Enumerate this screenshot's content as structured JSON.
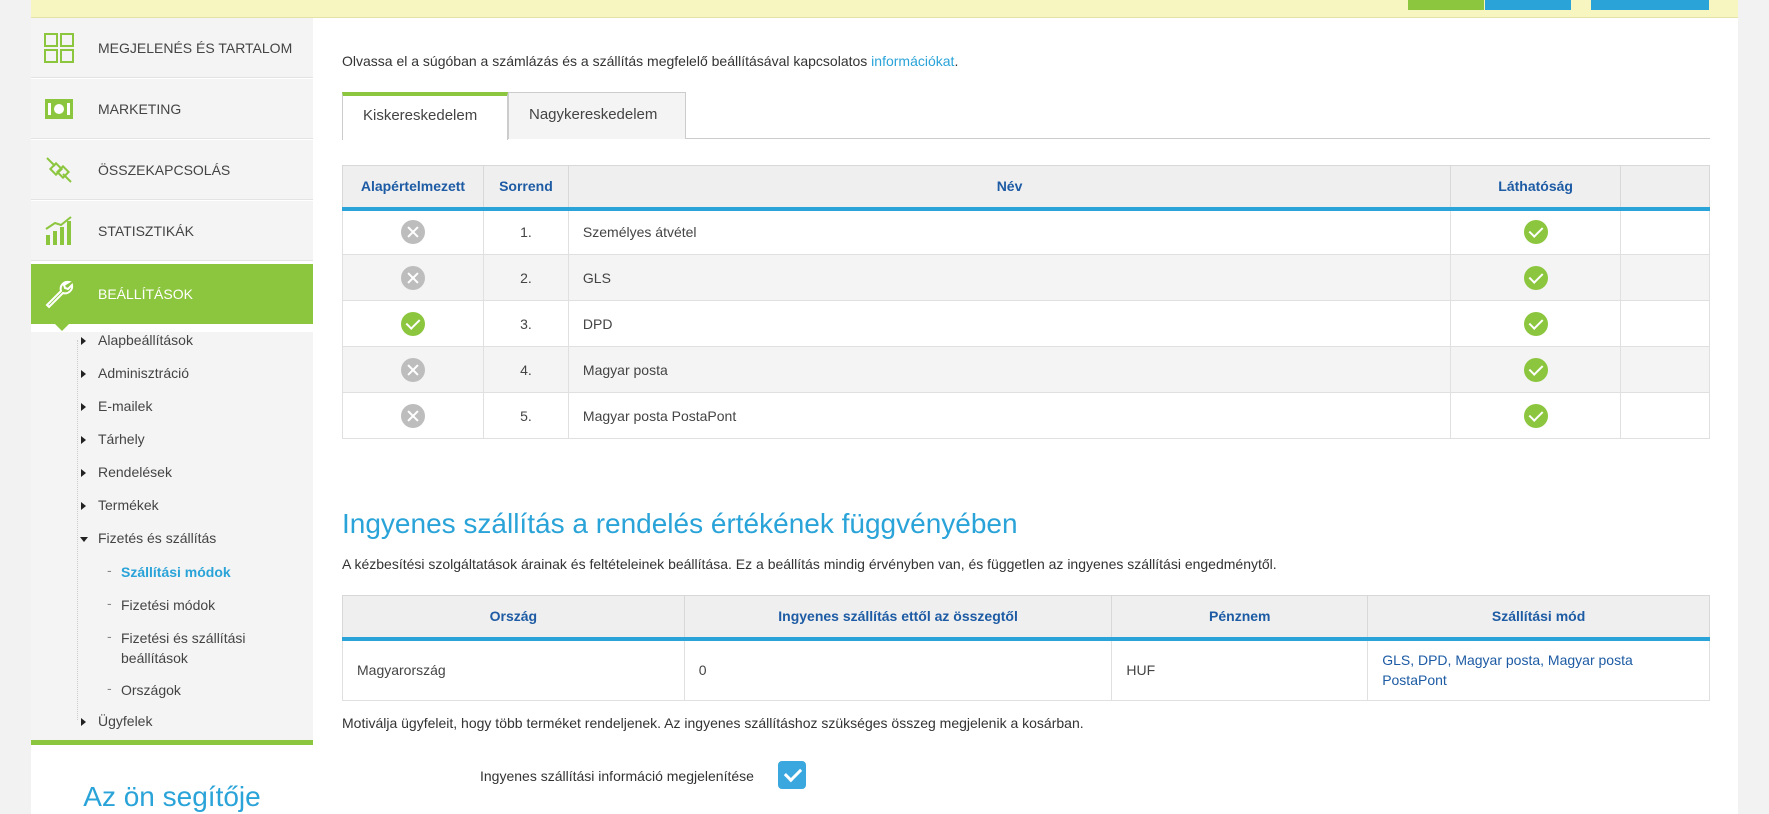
{
  "sidebar": {
    "menu": [
      {
        "label": "MEGJELENÉS ÉS TARTALOM",
        "icon": "layout-grid-icon"
      },
      {
        "label": "MARKETING",
        "icon": "money-icon"
      },
      {
        "label": "ÖSSZEKAPCSOLÁS",
        "icon": "plug-icon"
      },
      {
        "label": "STATISZTIKÁK",
        "icon": "chart-icon"
      },
      {
        "label": "BEÁLLÍTÁSOK",
        "icon": "wrench-icon"
      }
    ],
    "submenu": [
      "Alapbeállítások",
      "Adminisztráció",
      "E-mailek",
      "Tárhely",
      "Rendelések",
      "Termékek",
      "Fizetés és szállítás"
    ],
    "subsubmenu": [
      "Szállítási módok",
      "Fizetési módok",
      "Fizetési és szállítási beállítások",
      "Országok"
    ],
    "last_item": "Ügyfelek",
    "helper_title": "Az ön segítője"
  },
  "main": {
    "intro_text": "Olvassa el a súgóban a számlázás és a szállítás megfelelő beállításával kapcsolatos ",
    "intro_link": "információkat",
    "intro_end": ".",
    "tabs": [
      "Kiskereskedelem",
      "Nagykereskedelem"
    ],
    "shipping_table": {
      "headers": [
        "Alapértelmezett",
        "Sorrend",
        "Név",
        "Láthatóság",
        ""
      ],
      "rows": [
        {
          "default": false,
          "order": "1.",
          "name": "Személyes átvétel",
          "visible": true
        },
        {
          "default": false,
          "order": "2.",
          "name": "GLS",
          "visible": true
        },
        {
          "default": true,
          "order": "3.",
          "name": "DPD",
          "visible": true
        },
        {
          "default": false,
          "order": "4.",
          "name": "Magyar posta",
          "visible": true
        },
        {
          "default": false,
          "order": "5.",
          "name": "Magyar posta PostaPont",
          "visible": true
        }
      ]
    },
    "free_shipping": {
      "title": "Ingyenes szállítás a rendelés értékének függvényében",
      "description": "A kézbesítési szolgáltatások árainak és feltételeinek beállítása. Ez a beállítás mindig érvényben van, és független az ingyenes szállítási engedménytől.",
      "headers": [
        "Ország",
        "Ingyenes szállítás ettől az összegtől",
        "Pénznem",
        "Szállítási mód"
      ],
      "rows": [
        {
          "country": "Magyarország",
          "amount": "0",
          "currency": "HUF",
          "methods": "GLS, DPD, Magyar posta, Magyar posta PostaPont"
        }
      ],
      "motivation": "Motiválja ügyfeleit, hogy több terméket rendeljenek. Az ingyenes szállításhoz szükséges összeg megjelenik a kosárban.",
      "checkbox_label": "Ingyenes szállítási információ megjelenítése",
      "checkbox_checked": true
    }
  },
  "colors": {
    "accent_green": "#8cc63e",
    "accent_blue": "#29a3d8",
    "header_blue": "#1d5ba4"
  }
}
